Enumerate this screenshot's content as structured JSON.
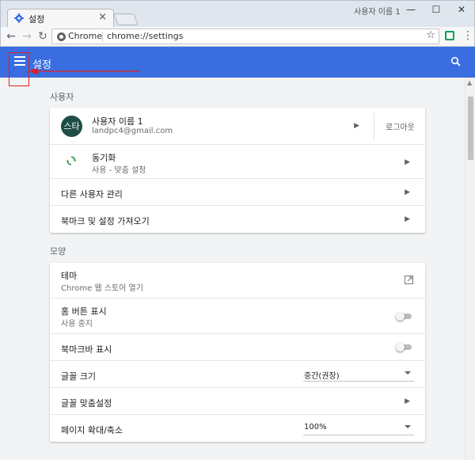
{
  "window": {
    "tab_title": "설정",
    "tab_close": "×",
    "profile_name": "사용자 이름 1",
    "minimize": "—",
    "maximize": "☐",
    "close": "✕"
  },
  "toolbar": {
    "back": "←",
    "forward": "→",
    "reload": "↻",
    "omnibox_chip": "Chrome",
    "url": "chrome://settings",
    "star": "☆",
    "menu": "⋮"
  },
  "header": {
    "title": "설정",
    "menu_icon": "hamburger-menu-icon",
    "search_icon": "search-icon",
    "background_color": "#3a6ee0"
  },
  "annotation": {
    "color": "#e02020"
  },
  "people_section": {
    "label": "사용자",
    "profile": {
      "avatar_text": "스타",
      "name": "사용자 이름 1",
      "email": "landpc4@gmail.com",
      "logout_label": "로그아웃"
    },
    "sync": {
      "title": "동기화",
      "subtitle": "사용 - 맞춤 설정"
    },
    "manage_others": "다른 사용자 관리",
    "import": "북마크 및 설정 가져오기"
  },
  "appearance_section": {
    "label": "모양",
    "theme": {
      "title": "테마",
      "subtitle": "Chrome 웹 스토어 열기"
    },
    "home_button": {
      "title": "홈 버튼 표시",
      "subtitle": "사용 중지",
      "enabled": false
    },
    "bookmarks_bar": {
      "title": "북마크바 표시",
      "enabled": false
    },
    "font_size": {
      "title": "글꼴 크기",
      "value": "중간(권장)"
    },
    "customize_fonts": "글꼴 맞춤설정",
    "page_zoom": {
      "title": "페이지 확대/축소",
      "value": "100%"
    }
  },
  "chevron": "▶"
}
